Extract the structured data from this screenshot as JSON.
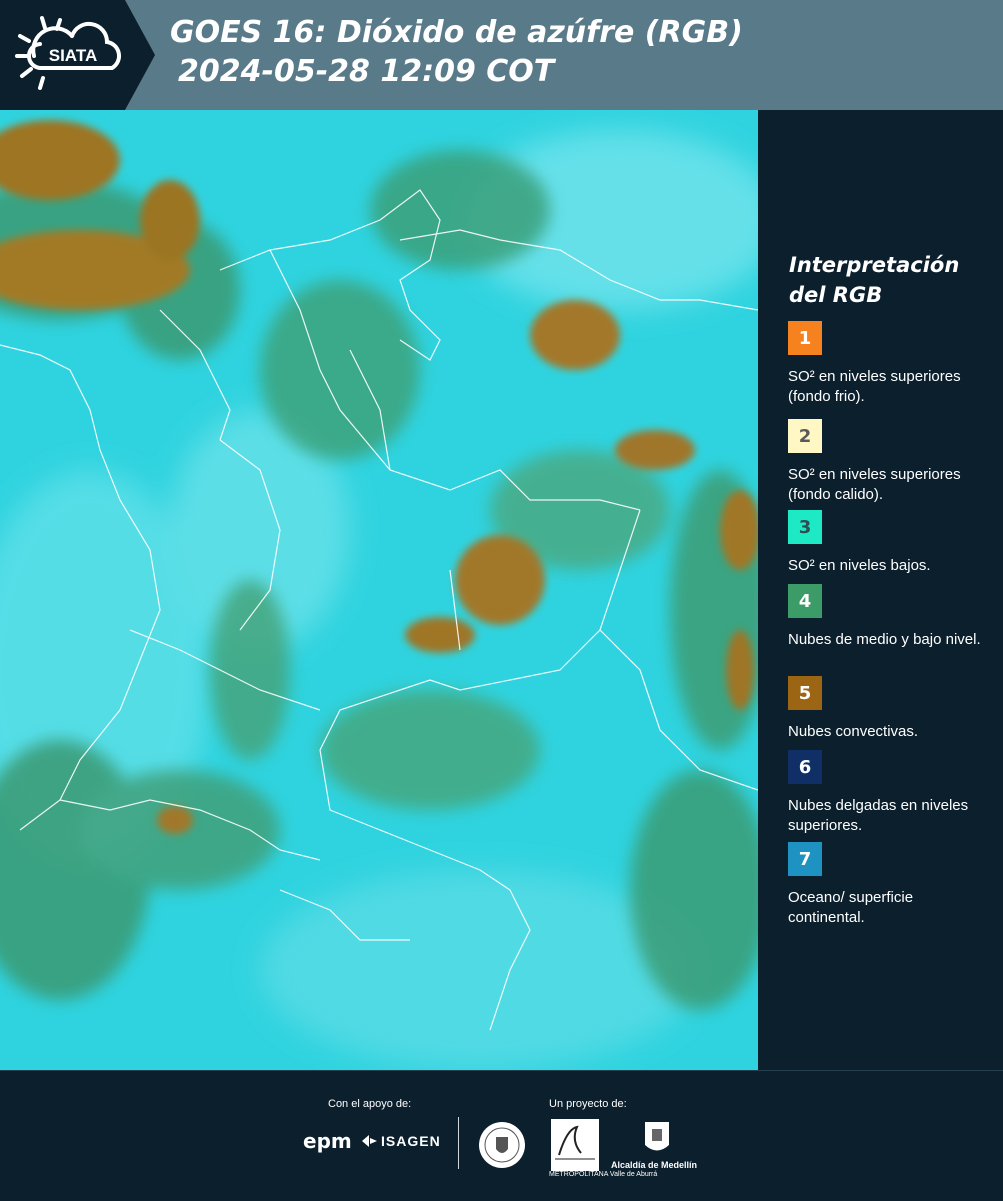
{
  "header": {
    "logo_text": "SIATA",
    "title_line1": "GOES 16: Dióxido de azúfre (RGB)",
    "title_line2": "2024-05-28 12:09 COT"
  },
  "legend": {
    "title_line1": "Interpretación",
    "title_line2": "del RGB",
    "items": [
      {
        "num": "1",
        "color": "#f5821f",
        "num_color": "#ffffff",
        "text": "SO² en niveles superiores (fondo frio)."
      },
      {
        "num": "2",
        "color": "#fff8c4",
        "num_color": "#5a5a5a",
        "text": "SO² en niveles superiores (fondo calido)."
      },
      {
        "num": "3",
        "color": "#1de9c4",
        "num_color": "#2d4e55",
        "text": "SO² en niveles bajos."
      },
      {
        "num": "4",
        "color": "#3c9c68",
        "num_color": "#ffffff",
        "text": "Nubes de medio y bajo nivel."
      },
      {
        "num": "5",
        "color": "#9c6513",
        "num_color": "#ffffff",
        "text": "Nubes convectivas."
      },
      {
        "num": "6",
        "color": "#0f2f66",
        "num_color": "#ffffff",
        "text": "Nubes delgadas en niveles superiores."
      },
      {
        "num": "7",
        "color": "#1e92c0",
        "num_color": "#ffffff",
        "text": "Oceano/ superficie continental."
      }
    ]
  },
  "footer": {
    "support_label": "Con el apoyo de:",
    "project_label": "Un proyecto de:",
    "epm": "epm",
    "isagen": "ISAGEN",
    "area_text": "METROPOLITANA Valle de Aburrá",
    "alcaldia": "Alcaldía de Medellín"
  }
}
